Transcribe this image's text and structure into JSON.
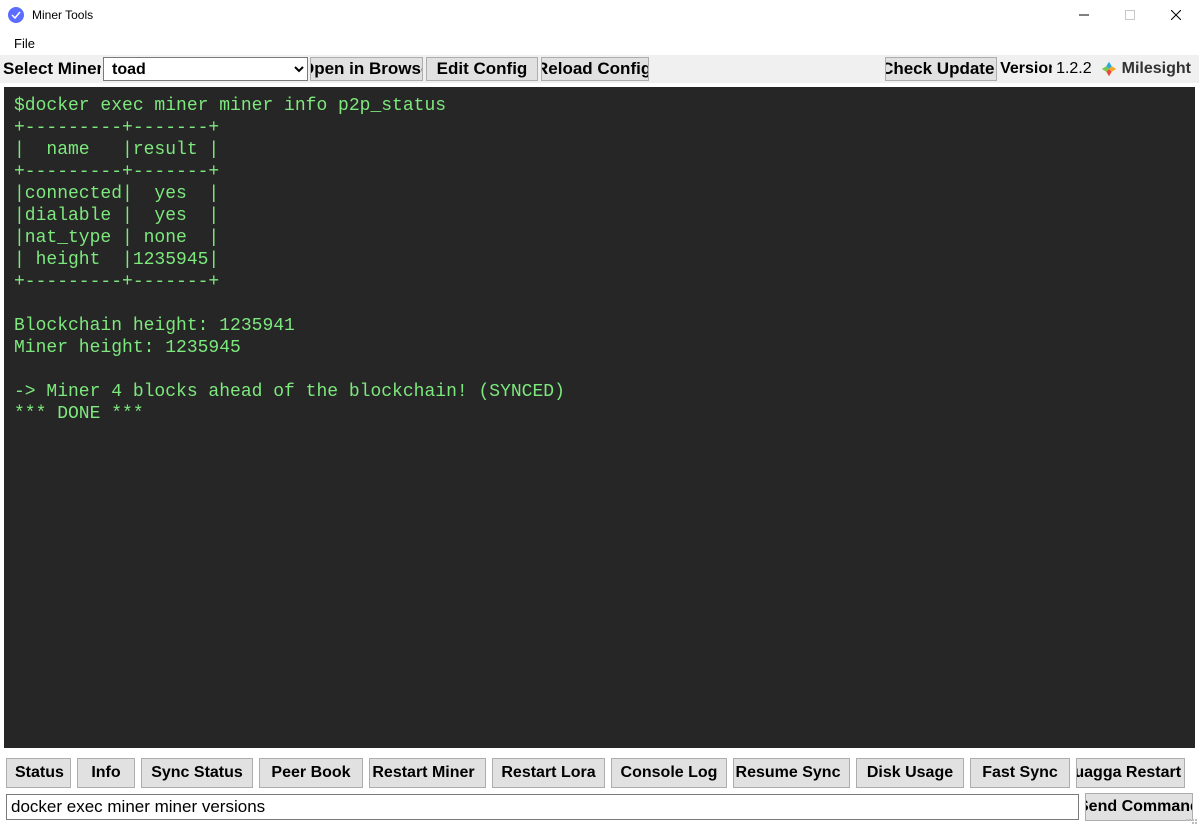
{
  "window": {
    "title": "Miner Tools"
  },
  "menubar": {
    "file": "File"
  },
  "toolbar": {
    "select_label": "Select Miner",
    "select_value": "toad",
    "open_browser": "Open in Browser",
    "edit_config": "Edit Config",
    "reload_config": "Reload Config",
    "check_update": "Check Update",
    "version_label": "Version",
    "version_value": "1.2.2",
    "brand": "Milesight"
  },
  "console": {
    "text": "$docker exec miner miner info p2p_status\n+---------+-------+\n|  name   |result |\n+---------+-------+\n|connected|  yes  |\n|dialable |  yes  |\n|nat_type | none  |\n| height  |1235945|\n+---------+-------+\n\nBlockchain height: 1235941\nMiner height: 1235945\n\n-> Miner 4 blocks ahead of the blockchain! (SYNCED)\n*** DONE ***"
  },
  "buttons": {
    "status": "Status",
    "info": "Info",
    "sync_status": "Sync Status",
    "peer_book": "Peer Book",
    "restart_miner": "Restart Miner",
    "restart_lora": "Restart Lora",
    "console_log": "Console Log",
    "resume_sync": "Resume Sync",
    "disk_usage": "Disk Usage",
    "fast_sync": "Fast Sync",
    "quagga_restart": "Quagga Restart"
  },
  "command": {
    "input_value": "docker exec miner miner versions",
    "send": "Send Command"
  }
}
